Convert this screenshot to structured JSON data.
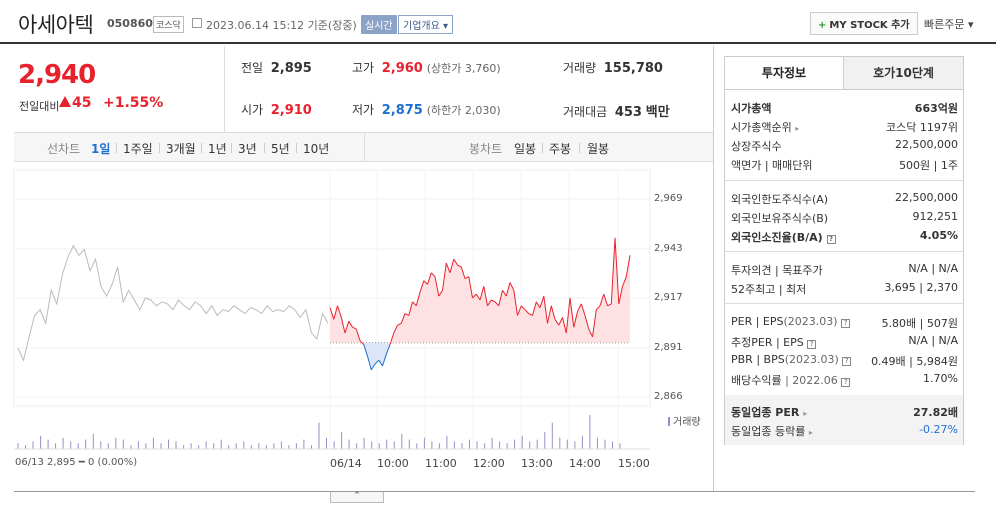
{
  "header": {
    "name": "아세아텍",
    "code": "050860",
    "market": "코스닥",
    "datetime": "2023.06.14 15:12  기준(장중)",
    "realtime": "실시간",
    "overview": "기업개요 ▾",
    "mystock": "MY STOCK 추가",
    "mystock_plus": "+",
    "quick_order": "빠른주문 ▾"
  },
  "price": {
    "current": "2,940",
    "compare_label": "전일대비",
    "change": "45",
    "change_pct": "+1.55%"
  },
  "quote": {
    "prev_label": "전일",
    "prev": "2,895",
    "high_label": "고가",
    "high": "2,960",
    "high_limit": "(상한가 3,760)",
    "volume_label": "거래량",
    "volume": "155,780",
    "open_label": "시가",
    "open": "2,910",
    "low_label": "저가",
    "low": "2,875",
    "low_limit": "(하한가 2,030)",
    "amount_label": "거래대금",
    "amount": "453",
    "amount_unit": "백만"
  },
  "period": {
    "line_label": "선차트",
    "periods": [
      "1일",
      "1주일",
      "3개월",
      "1년",
      "3년",
      "5년",
      "10년"
    ],
    "candle_label": "봉차트",
    "candles": [
      "일봉",
      "주봉",
      "월봉"
    ]
  },
  "chart_data": {
    "type": "line",
    "title": "",
    "y_ticks": [
      "2,969",
      "2,943",
      "2,917",
      "2,891",
      "2,866"
    ],
    "ylim": [
      2866,
      2969
    ],
    "baseline": 2895,
    "x_ticks": [
      "06/14",
      "10:00",
      "11:00",
      "12:00",
      "13:00",
      "14:00",
      "15:00"
    ],
    "prev_day_label": "06/13  2,895 ━ 0 (0.00%)",
    "volume_legend": "거래량",
    "series": [
      {
        "values": [
          2913,
          2907,
          2914,
          2908,
          2900,
          2906,
          2903,
          2902,
          2896,
          2894,
          2888,
          2881,
          2884,
          2886,
          2883,
          2889,
          2894,
          2900,
          2904,
          2905,
          2910,
          2909,
          2916,
          2914,
          2921,
          2927,
          2925,
          2931,
          2929,
          2919,
          2922,
          2936,
          2931,
          2938,
          2935,
          2934,
          2928,
          2929,
          2918,
          2920,
          2917,
          2924,
          2914,
          2917,
          2916,
          2914,
          2922,
          2919,
          2926,
          2922,
          2909,
          2914,
          2912,
          2910,
          2909,
          2916,
          2913,
          2919,
          2905,
          2914,
          2907,
          2904,
          2908,
          2900,
          2918,
          2903,
          2911,
          2915,
          2909,
          2902,
          2898,
          2912,
          2914,
          2920,
          2914,
          2915,
          2949,
          2915,
          2924,
          2929,
          2940
        ]
      }
    ],
    "prev_day_series": [
      2892,
      2886,
      2898,
      2909,
      2912,
      2905,
      2922,
      2915,
      2930,
      2939,
      2945,
      2940,
      2943,
      2932,
      2938,
      2924,
      2919,
      2925,
      2934,
      2916,
      2922,
      2917,
      2912,
      2918,
      2917,
      2914,
      2916,
      2915,
      2912,
      2917,
      2914,
      2912,
      2916,
      2914,
      2910,
      2914,
      2909,
      2912,
      2911,
      2914,
      2912,
      2910,
      2913,
      2912,
      2910,
      2914,
      2911,
      2912,
      2911,
      2914,
      2912,
      2908,
      2912,
      2900,
      2897,
      2910,
      2905
    ],
    "volume": [
      3,
      2,
      4,
      7,
      5,
      3,
      6,
      4,
      3,
      5,
      8,
      4,
      3,
      6,
      5,
      2,
      4,
      3,
      6,
      3,
      5,
      4,
      2,
      3,
      2,
      4,
      3,
      5,
      2,
      3,
      4,
      2,
      3,
      2,
      3,
      4,
      2,
      3,
      5,
      2,
      14,
      6,
      4,
      9,
      5,
      3,
      6,
      4,
      3,
      5,
      4,
      8,
      5,
      3,
      6,
      4,
      3,
      7,
      4,
      3,
      5,
      4,
      3,
      6,
      4,
      3,
      5,
      7,
      4,
      5,
      9,
      14,
      6,
      5,
      4,
      7,
      18,
      6,
      5,
      4,
      3
    ]
  },
  "panel": {
    "tab_info": "투자정보",
    "tab_orderbook": "호가10단계",
    "rows": {
      "mcap_l": "시가총액",
      "mcap_r": "663억원",
      "rank_l": "시가총액순위",
      "rank_r": "코스닥 1197위",
      "shares_l": "상장주식수",
      "shares_r": "22,500,000",
      "par_l": "액면가 | 매매단위",
      "par_r": "500원 | 1주",
      "flimit_l": "외국인한도주식수(A)",
      "flimit_r": "22,500,000",
      "fown_l": "외국인보유주식수(B)",
      "fown_r": "912,251",
      "fratio_l": "외국인소진율(B/A)",
      "fratio_r": "4.05%",
      "opinion_l": "투자의견 | 목표주가",
      "opinion_r": "N/A | N/A",
      "wk52_l": "52주최고 | 최저",
      "wk52_r": "3,695 | 2,370",
      "per_l": "PER | EPS",
      "per_date": "(2023.03)",
      "per_r": "5.80배 | 507원",
      "eper_l": "추정PER | EPS",
      "eper_r": "N/A | N/A",
      "pbr_l": "PBR | BPS",
      "pbr_date": "(2023.03)",
      "pbr_r": "0.49배 | 5,984원",
      "div_l": "배당수익률",
      "div_date": "| 2022.06",
      "div_r": "1.70%",
      "ind_per_l": "동일업종 PER",
      "ind_per_r": "27.82배",
      "ind_chg_l": "동일업종 등락률",
      "ind_chg_r": "-0.27%"
    }
  },
  "colors": {
    "up": "#e8222d",
    "down": "#1f6fd1",
    "prev_line": "#bbbbbb",
    "fill_up": "#fde1e3",
    "fill_down": "#dbe7f8"
  }
}
